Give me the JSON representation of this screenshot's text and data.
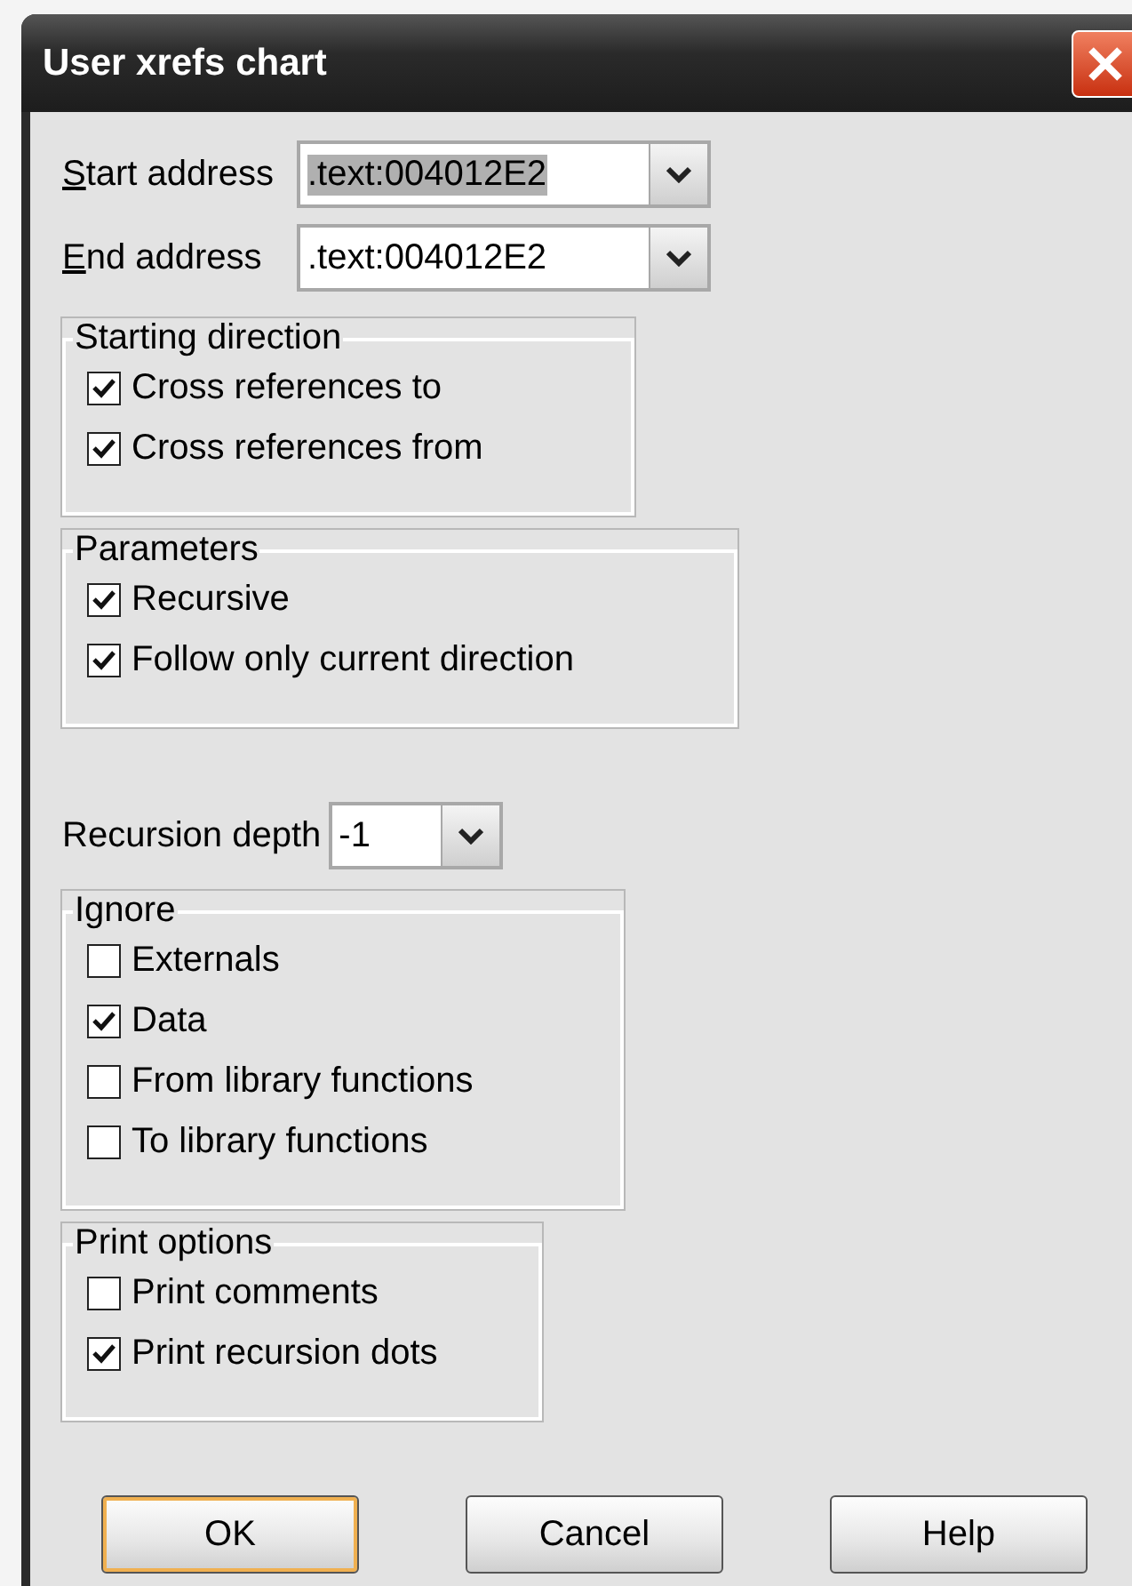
{
  "window": {
    "title": "User xrefs chart"
  },
  "address_fields": [
    {
      "label": "Start address",
      "mnemonic_first_letter": true,
      "value": ".text:004012E2",
      "text_selected": true
    },
    {
      "label": "End address",
      "mnemonic_first_letter": true,
      "value": ".text:004012E2",
      "text_selected": false
    }
  ],
  "starting_direction": {
    "title": "Starting direction",
    "options": [
      {
        "label": "Cross references to",
        "checked": true
      },
      {
        "label": "Cross references from",
        "checked": true
      }
    ]
  },
  "parameters": {
    "title": "Parameters",
    "options": [
      {
        "label": "Recursive",
        "checked": true
      },
      {
        "label": "Follow only current direction",
        "checked": true
      }
    ]
  },
  "recursion_depth": {
    "label": "Recursion depth",
    "value": "-1"
  },
  "ignore": {
    "title": "Ignore",
    "options": [
      {
        "label": "Externals",
        "checked": false
      },
      {
        "label": "Data",
        "checked": true
      },
      {
        "label": "From library functions",
        "checked": false
      },
      {
        "label": "To library functions",
        "checked": false
      }
    ]
  },
  "print_options": {
    "title": "Print options",
    "options": [
      {
        "label": "Print comments",
        "checked": false
      },
      {
        "label": "Print recursion dots",
        "checked": true
      }
    ]
  },
  "buttons": [
    {
      "label": "OK",
      "default": true
    },
    {
      "label": "Cancel",
      "default": false
    },
    {
      "label": "Help",
      "default": false
    }
  ]
}
